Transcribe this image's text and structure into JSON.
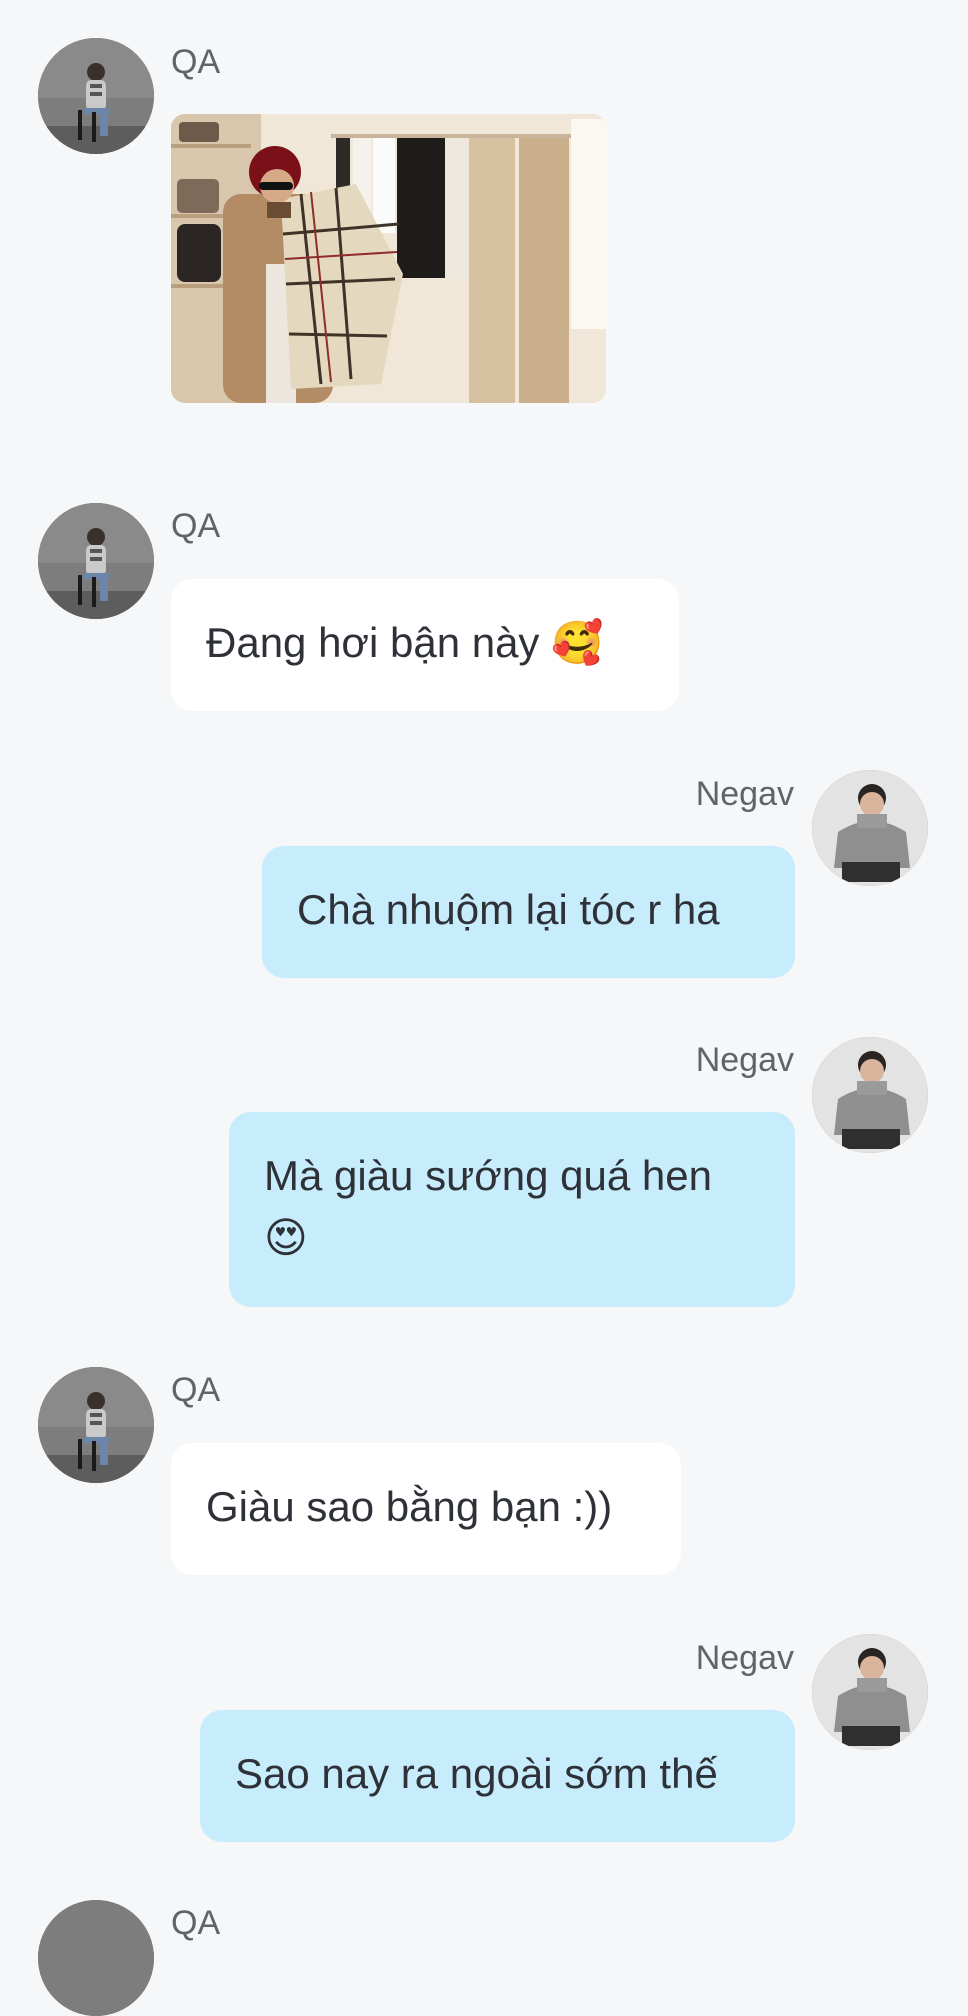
{
  "messages": [
    {
      "sender": "QA",
      "type": "image",
      "image_description": "photo"
    },
    {
      "sender": "QA",
      "type": "text",
      "text": "Đang hơi bận này",
      "emoji": "🥰"
    },
    {
      "sender": "Negav",
      "type": "text",
      "text": "Chà nhuộm lại tóc r ha"
    },
    {
      "sender": "Negav",
      "type": "text",
      "text_line1": "Mà giàu sướng quá hen",
      "emoji": "😍"
    },
    {
      "sender": "QA",
      "type": "text",
      "text": "Giàu sao bằng bạn :))"
    },
    {
      "sender": "Negav",
      "type": "text",
      "text": "Sao nay ra ngoài sớm thế"
    },
    {
      "sender": "QA",
      "type": "partial"
    }
  ],
  "colors": {
    "background": "#f6f7f9",
    "incoming_bubble": "#ffffff",
    "outgoing_bubble": "#c7ecfb",
    "name_text": "#5f636a",
    "message_text": "#2e3137"
  },
  "icons": {
    "qa_avatar": "avatar-qa-photo",
    "negav_avatar": "avatar-negav-photo"
  }
}
